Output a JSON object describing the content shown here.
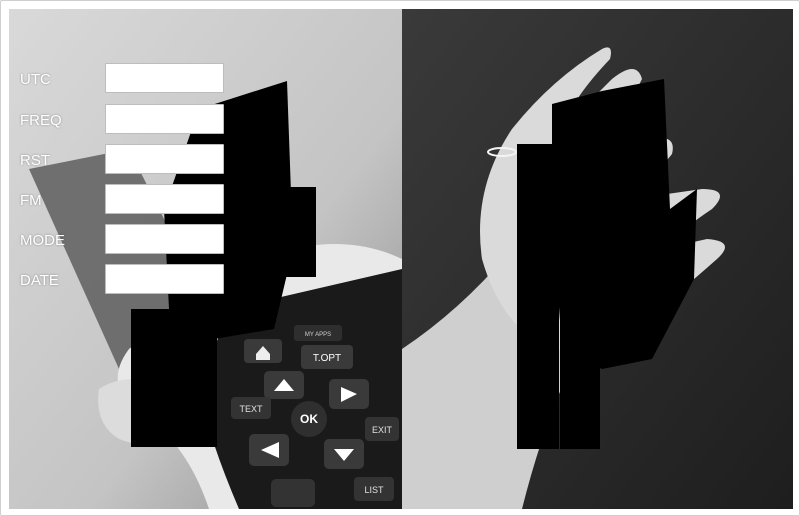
{
  "form": {
    "fields": [
      {
        "label": "UTC",
        "value": ""
      },
      {
        "label": "FREQ",
        "value": ""
      },
      {
        "label": "RST",
        "value": ""
      },
      {
        "label": "FM",
        "value": ""
      },
      {
        "label": "MODE",
        "value": ""
      },
      {
        "label": "DATE",
        "value": ""
      }
    ]
  },
  "remote": {
    "keys": [
      "T.OPT",
      "OK",
      "EXIT",
      "TEXT",
      "LIST",
      "MY APPS"
    ]
  },
  "colors": {
    "label_text": "#ffffff",
    "redaction": "#000000",
    "left_photo_bg": "#cfcfcf",
    "right_photo_bg": "#2b2b2b"
  }
}
